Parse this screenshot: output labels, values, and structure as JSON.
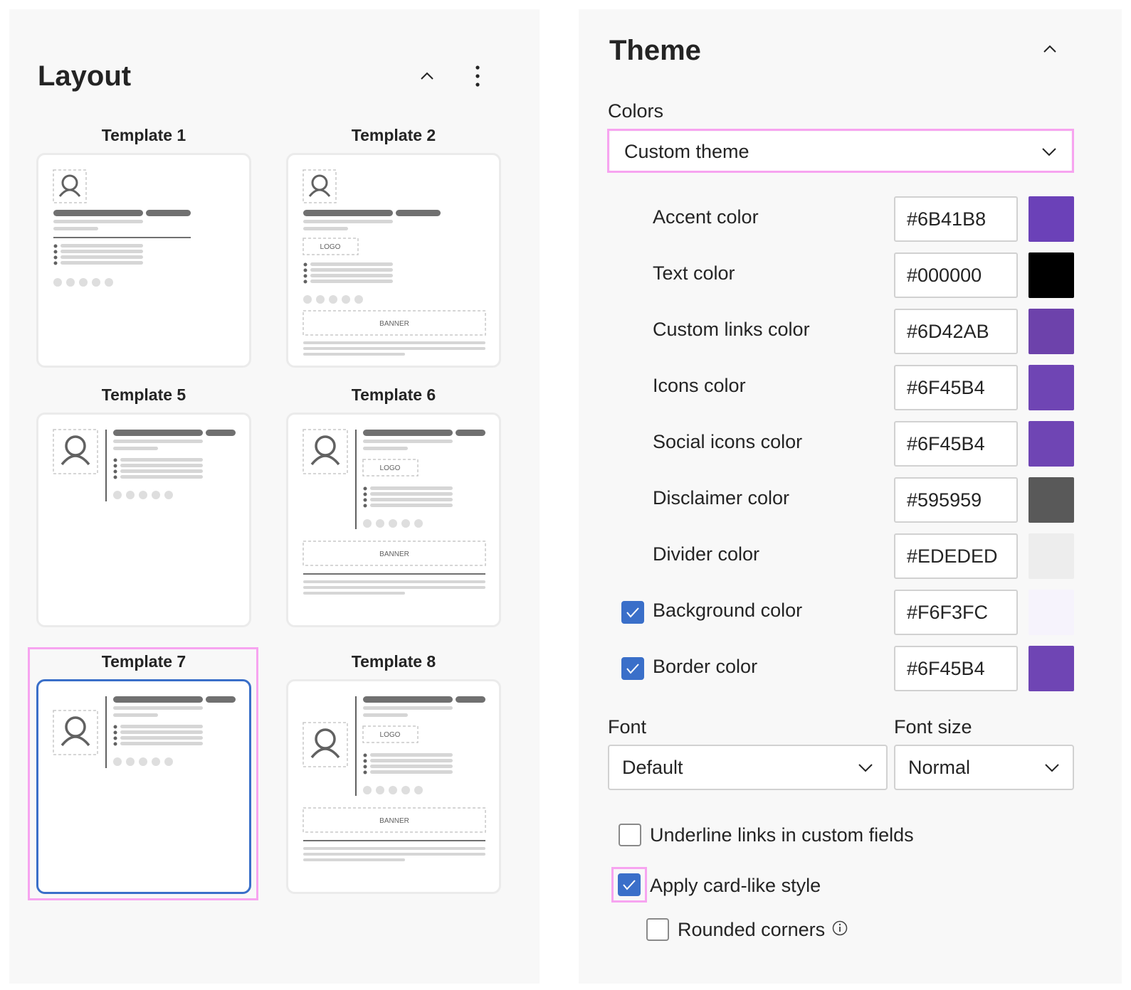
{
  "layout": {
    "title": "Layout",
    "templates": [
      {
        "label": "Template 1",
        "selected": false
      },
      {
        "label": "Template 2",
        "selected": false
      },
      {
        "label": "Template 5",
        "selected": false
      },
      {
        "label": "Template 6",
        "selected": false
      },
      {
        "label": "Template 7",
        "selected": true
      },
      {
        "label": "Template 8",
        "selected": false
      }
    ],
    "thumb_text": {
      "logo": "LOGO",
      "banner": "BANNER"
    }
  },
  "theme": {
    "title": "Theme",
    "colors_label": "Colors",
    "colors_value": "Custom theme",
    "color_rows": [
      {
        "label": "Accent color",
        "value": "#6B41B8",
        "swatch": "#6b41b8",
        "has_checkbox": false
      },
      {
        "label": "Text color",
        "value": "#000000",
        "swatch": "#000000",
        "has_checkbox": false
      },
      {
        "label": "Custom links color",
        "value": "#6D42AB",
        "swatch": "#6d42ab",
        "has_checkbox": false
      },
      {
        "label": "Icons color",
        "value": "#6F45B4",
        "swatch": "#6f45b4",
        "has_checkbox": false
      },
      {
        "label": "Social icons color",
        "value": "#6F45B4",
        "swatch": "#6f45b4",
        "has_checkbox": false
      },
      {
        "label": "Disclaimer color",
        "value": "#595959",
        "swatch": "#595959",
        "has_checkbox": false
      },
      {
        "label": "Divider color",
        "value": "#EDEDED",
        "swatch": "#ededed",
        "has_checkbox": false
      },
      {
        "label": "Background color",
        "value": "#F6F3FC",
        "swatch": "#f6f3fc",
        "has_checkbox": true,
        "checked": true
      },
      {
        "label": "Border color",
        "value": "#6F45B4",
        "swatch": "#6f45b4",
        "has_checkbox": true,
        "checked": true
      }
    ],
    "font_label": "Font",
    "font_value": "Default",
    "font_size_label": "Font size",
    "font_size_value": "Normal",
    "underline_label": "Underline links in custom fields",
    "underline_checked": false,
    "card_style_label": "Apply card-like style",
    "card_style_checked": true,
    "rounded_label": "Rounded corners",
    "rounded_checked": false
  },
  "icons": {
    "collapse": "chevron-up-icon",
    "more": "more-vertical-icon",
    "dropdown": "chevron-down-icon",
    "info": "info-icon",
    "avatar": "person-icon",
    "check": "checkmark-icon"
  },
  "colors": {
    "accent_selected": "#3a6fc9",
    "highlight": "#f7a4f0",
    "panel_bg": "#f8f8f8"
  }
}
